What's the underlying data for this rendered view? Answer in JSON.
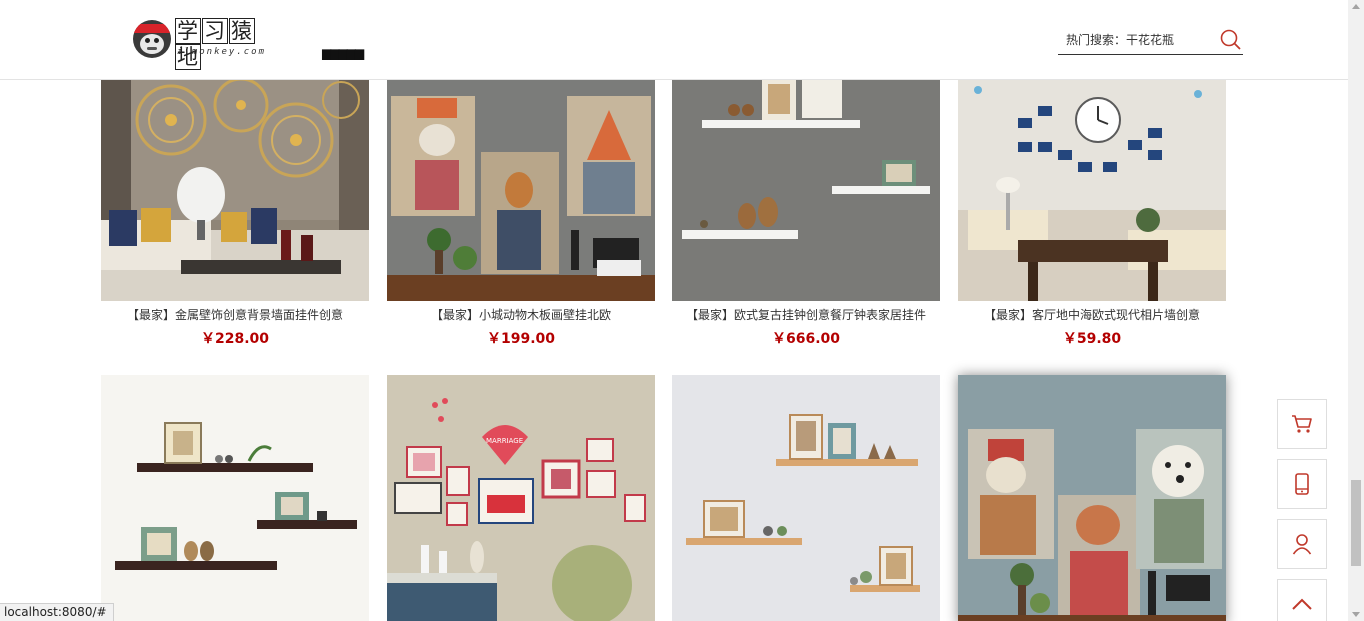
{
  "header": {
    "logo_text": [
      "学",
      "习",
      "猿",
      "地"
    ],
    "logo_url": "ilmonkey.com",
    "nav_garbled": "▆▆▆▆▆",
    "search_placeholder": "热门搜索：干花花瓶"
  },
  "products_row1": [
    {
      "title": "【最家】金属壁饰创意背景墙面挂件创意",
      "price": "￥228.00"
    },
    {
      "title": "【最家】小城动物木板画壁挂北欧",
      "price": "￥199.00"
    },
    {
      "title": "【最家】欧式复古挂钟创意餐厅钟表家居挂件",
      "price": "￥666.00"
    },
    {
      "title": "【最家】客厅地中海欧式现代相片墙创意",
      "price": "￥59.80"
    }
  ],
  "side_buttons": [
    "cart-icon",
    "phone-icon",
    "user-icon",
    "back-to-top-icon"
  ],
  "status_url": "localhost:8080/#",
  "colors": {
    "price": "#b30000",
    "accent_red": "#d8232a"
  }
}
